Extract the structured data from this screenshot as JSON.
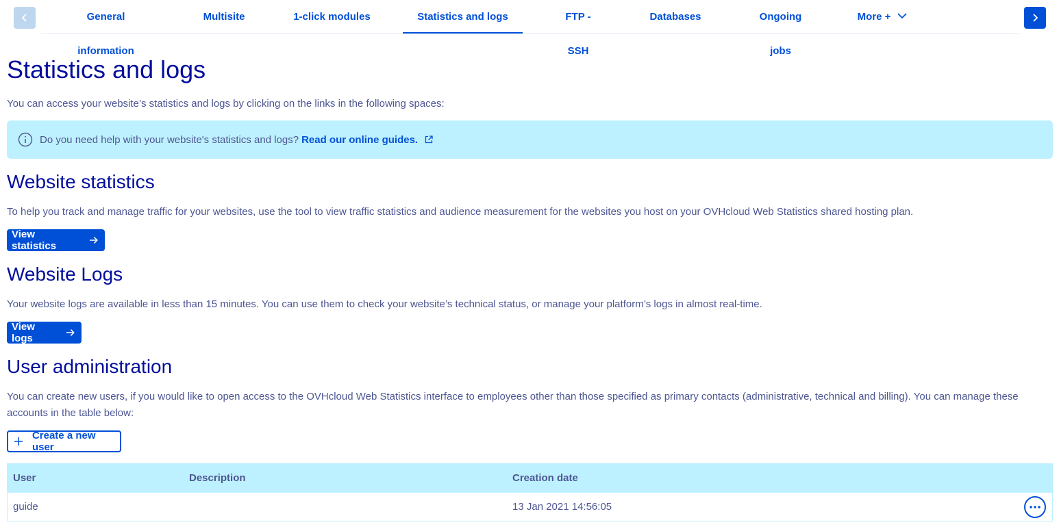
{
  "tabs": {
    "items": [
      {
        "label": "General information"
      },
      {
        "label": "Multisite"
      },
      {
        "label": "1-click modules"
      },
      {
        "label": "Statistics and logs"
      },
      {
        "label": "FTP - SSH"
      },
      {
        "label": "Databases"
      },
      {
        "label": "Ongoing jobs"
      },
      {
        "label": "More +"
      }
    ],
    "active": "Statistics and logs",
    "prev_icon": "chevron-left-icon",
    "next_icon": "chevron-right-icon"
  },
  "page": {
    "title": "Statistics and logs",
    "intro": "You can access your website’s statistics and logs by clicking on the links in the following spaces:"
  },
  "banner": {
    "icon": "info-icon",
    "text": "Do you need help with your website's statistics and logs?",
    "link": "Read our online guides.",
    "link_icon": "external-link-icon"
  },
  "stats": {
    "heading": "Website statistics",
    "description": "To help you track and manage traffic for your websites, use the tool to view traffic statistics and audience measurement for the websites you host on your OVHcloud Web Statistics shared hosting plan.",
    "button": "View statistics"
  },
  "logs": {
    "heading": "Website Logs",
    "description": "Your website logs are available in less than 15 minutes. You can use them to check your website’s technical status, or manage your platform’s logs in almost real-time.",
    "button": "View logs"
  },
  "users": {
    "heading": "User administration",
    "description": "You can create new users, if you would like to open access to the OVHcloud Web Statistics interface to employees other than those specified as primary contacts (administrative, technical and billing). You can manage these accounts in the table below:",
    "create_button": "Create a new user",
    "table": {
      "headers": [
        "User",
        "Description",
        "Creation date"
      ],
      "rows": [
        {
          "user": "guide",
          "description": "",
          "created": "13 Jan 2021 14:56:05"
        }
      ]
    }
  },
  "colors": {
    "primary": "#0050d7",
    "heading": "#000e9c",
    "text": "#4d5693",
    "banner_bg": "#bef1ff",
    "disabled_arrow": "#bfd6ef"
  }
}
